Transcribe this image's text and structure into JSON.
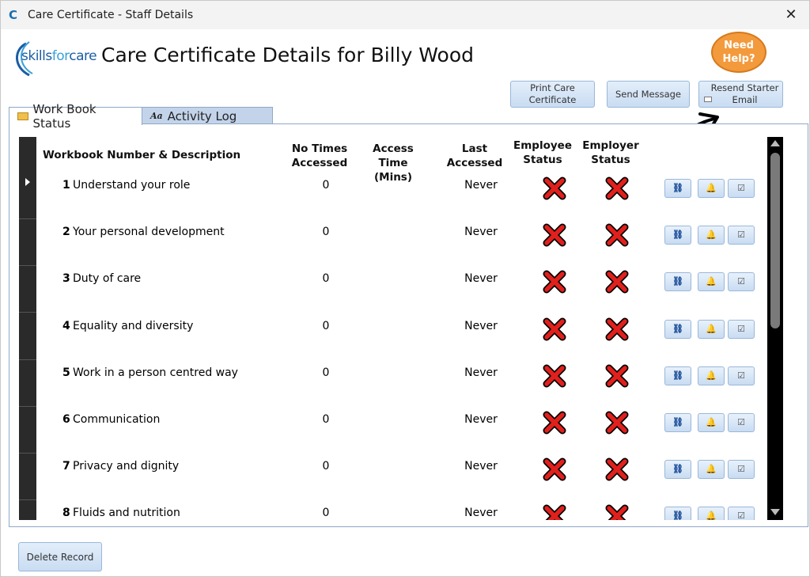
{
  "window": {
    "title": "Care Certificate - Staff Details",
    "close_glyph": "✕"
  },
  "logo": {
    "word1": "skills",
    "word2": "for",
    "word3": "care"
  },
  "page_title": "Care Certificate Details for Billy Wood",
  "help": {
    "line1": "Need",
    "line2": "Help?"
  },
  "toolbar": {
    "print_line1": "Print Care",
    "print_line2": "Certificate",
    "send_label": "Send Message",
    "resend_line1": "Resend Starter",
    "resend_line2": "Email"
  },
  "tabs": [
    {
      "label": "Work Book Status",
      "icon": "folder-icon",
      "active": true
    },
    {
      "label": "Activity Log",
      "icon": "text-format-icon",
      "active": false
    }
  ],
  "columns": {
    "desc": "Workbook Number & Description",
    "times_l1": "No Times",
    "times_l2": "Accessed",
    "access_l1": "Access",
    "access_l2": "Time (Mins)",
    "last_l1": "Last",
    "last_l2": "Accessed",
    "emp_l1": "Employee",
    "emp_l2": "Status",
    "empr_l1": "Employer",
    "empr_l2": "Status"
  },
  "rows": [
    {
      "num": "1",
      "desc": "Understand your role",
      "times": "0",
      "last": "Never"
    },
    {
      "num": "2",
      "desc": "Your personal development",
      "times": "0",
      "last": "Never"
    },
    {
      "num": "3",
      "desc": "Duty of care",
      "times": "0",
      "last": "Never"
    },
    {
      "num": "4",
      "desc": "Equality and diversity",
      "times": "0",
      "last": "Never"
    },
    {
      "num": "5",
      "desc": "Work in a person centred way",
      "times": "0",
      "last": "Never"
    },
    {
      "num": "6",
      "desc": "Communication",
      "times": "0",
      "last": "Never"
    },
    {
      "num": "7",
      "desc": "Privacy and dignity",
      "times": "0",
      "last": "Never"
    },
    {
      "num": "8",
      "desc": "Fluids and nutrition",
      "times": "0",
      "last": "Never"
    }
  ],
  "row_buttons": {
    "view": "⛓",
    "bell": "🔔",
    "check": "☑"
  },
  "delete_label": "Delete Record",
  "colors": {
    "accent": "#1b5ea6",
    "help_orange": "#f39a3c",
    "x_red": "#e0201c"
  }
}
